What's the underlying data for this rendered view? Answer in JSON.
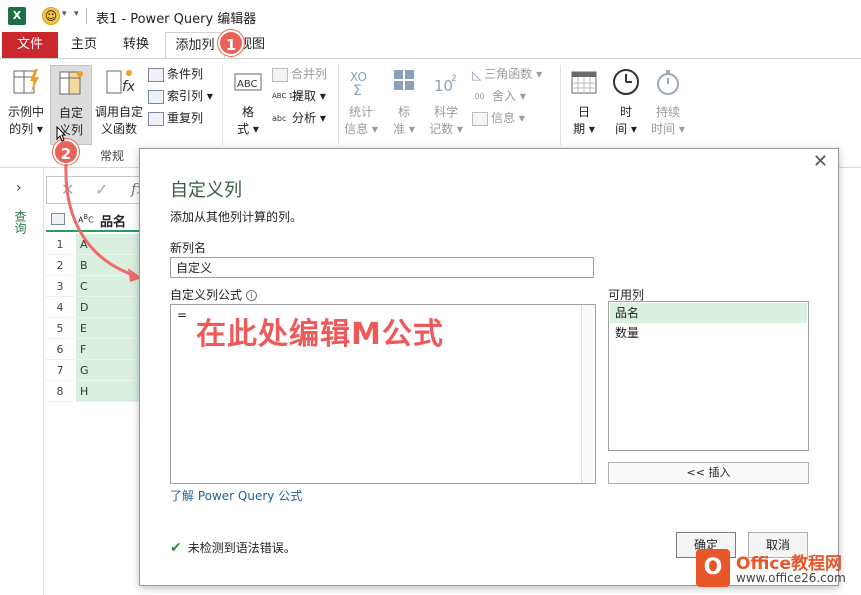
{
  "titlebar": {
    "app_badge": "X",
    "title": "表1 - Power Query 编辑器"
  },
  "tabs": {
    "file": "文件",
    "home": "主页",
    "transform": "转换",
    "add_column": "添加列",
    "view": "视图"
  },
  "badges": {
    "one": "1",
    "two": "2"
  },
  "ribbon": {
    "example_col": [
      "示例中",
      "的列"
    ],
    "custom_col": [
      "自定",
      "义列"
    ],
    "invoke_func": [
      "调用自定",
      "义函数"
    ],
    "cond_col": "条件列",
    "index_col": "索引列",
    "dup_col": "重复列",
    "format": [
      "格",
      "式"
    ],
    "merge_col": "合并列",
    "extract": "提取",
    "parse": "分析",
    "stats": [
      "统计",
      "信息"
    ],
    "standard": [
      "标",
      "准"
    ],
    "scientific": [
      "科学",
      "记数"
    ],
    "trig": "三角函数",
    "rounding": "舍入",
    "info": "信息",
    "date": [
      "日",
      "期"
    ],
    "time": [
      "时",
      "间"
    ],
    "duration": [
      "持续",
      "时间"
    ],
    "group_general": "常规",
    "format_icon_text": "ABC",
    "extract_icon_text": "ABC 123",
    "parse_icon_text": "abc"
  },
  "leftpane": {
    "queries_label": "查询",
    "col_header": "品名",
    "fx": "fx",
    "rows": [
      {
        "n": "1",
        "v": "A"
      },
      {
        "n": "2",
        "v": "B"
      },
      {
        "n": "3",
        "v": "C"
      },
      {
        "n": "4",
        "v": "D"
      },
      {
        "n": "5",
        "v": "E"
      },
      {
        "n": "6",
        "v": "F"
      },
      {
        "n": "7",
        "v": "G"
      },
      {
        "n": "8",
        "v": "H"
      }
    ]
  },
  "dialog": {
    "title": "自定义列",
    "subtitle": "添加从其他列计算的列。",
    "newcol_label": "新列名",
    "newcol_value": "自定义",
    "formula_label": "自定义列公式",
    "formula_value": "=",
    "overlay": "在此处编辑M公式",
    "avail_label": "可用列",
    "avail_items": [
      "品名",
      "数量"
    ],
    "insert": "<< 插入",
    "learn_link": "了解 Power Query 公式",
    "status": "未检测到语法错误。",
    "ok": "确定",
    "cancel": "取消"
  },
  "watermark": {
    "brand": "Office教程网",
    "url": "www.office26.com"
  },
  "colors": {
    "excel_green": "#1e7145",
    "file_tab": "#c8282e",
    "badge": "#e8625a",
    "grid_fill": "#d9efe0",
    "dialog_title": "#35603f",
    "overlay_red": "#ee5a5a",
    "link": "#1f5f9c",
    "selected_item": "#d9efe0"
  }
}
